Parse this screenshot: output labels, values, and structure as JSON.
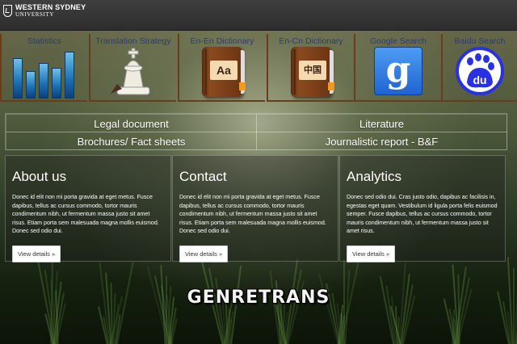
{
  "header": {
    "logo_line1": "WESTERN SYDNEY",
    "logo_line2": "UNIVERSITY"
  },
  "tools": [
    {
      "label": "Statistics",
      "icon": "bar-chart-icon"
    },
    {
      "label": "Translation Strategy",
      "icon": "chess-king-icon"
    },
    {
      "label": "En-En Dictionary",
      "icon": "dictionary-book-icon",
      "face": "Aa"
    },
    {
      "label": "En-Cn Dictionary",
      "icon": "dictionary-book-icon",
      "face": "中国"
    },
    {
      "label": "Google Search",
      "icon": "google-icon",
      "face": "g"
    },
    {
      "label": "Baidu Search",
      "icon": "baidu-paw-icon",
      "face": "du"
    }
  ],
  "categories": [
    "Legal document",
    "Literature",
    "Brochures/ Fact sheets",
    "Journalistic report - B&F"
  ],
  "columns": [
    {
      "title": "About us",
      "text": "Donec id elit non mi porta gravida at eget metus. Fusce dapibus, tellus ac cursus commodo, tortor mauris condimentum nibh, ut fermentum massa justo sit amet risus. Etiam porta sem malesuada magna mollis euismod. Donec sed odio dui.",
      "button": "View details »"
    },
    {
      "title": "Contact",
      "text": "Donec id elit non mi porta gravida at eget metus. Fusce dapibus, tellus ac cursus commodo, tortor mauris condimentum nibh, ut fermentum massa justo sit amet risus. Etiam porta sem malesuada magna mollis euismod. Donec sed odio dui.",
      "button": "View details »"
    },
    {
      "title": "Analytics",
      "text": "Donec sed odio dui. Cras justo odio, dapibus ac facilisis in, egestas eget quam. Vestibulum id ligula porta felis euismod semper. Fusce dapibus, tellus ac cursus commodo, tortor mauris condimentum nibh, ut fermentum massa justo sit amet risus.",
      "button": "View details »"
    }
  ],
  "brand": "GENRETRANS",
  "colors": {
    "topbar": "#2d2d2d",
    "tool_border": "#6b3c1a",
    "tool_label": "#2c3d6b",
    "google_blue": "#1f64d0",
    "baidu_blue": "#2932e1"
  }
}
